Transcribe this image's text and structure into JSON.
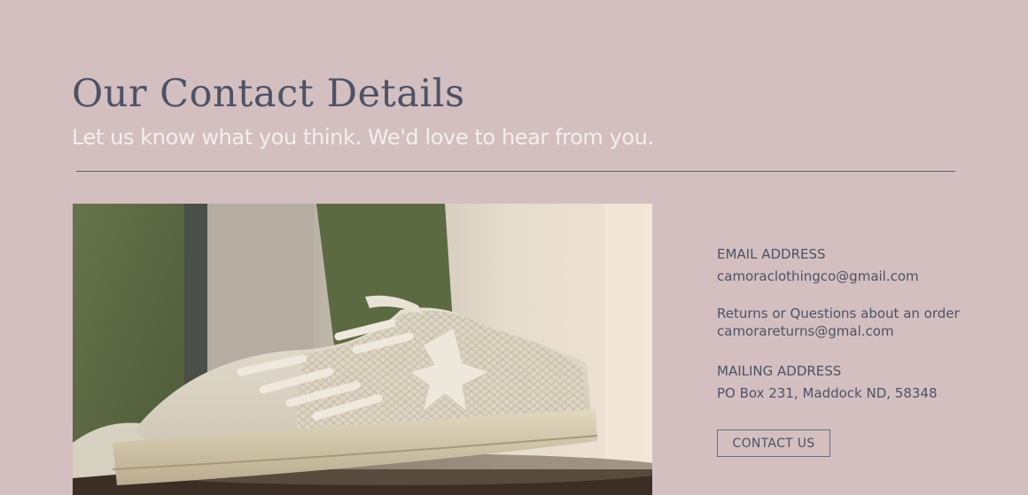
{
  "header": {
    "title": "Our Contact Details",
    "subtitle": "Let us know what you think. We'd love to hear from you."
  },
  "image": {
    "subject": "white star sneaker",
    "icon": "sneaker-photo"
  },
  "contact": {
    "email_label": "EMAIL ADDRESS",
    "email_value": "camoraclothingco@gmail.com",
    "returns_label": "Returns or Questions about an order",
    "returns_value": "camorareturns@gmal.com",
    "mailing_label": "MAILING ADDRESS",
    "mailing_value": "PO Box 231, Maddock ND, 58348"
  },
  "actions": {
    "contact_button": "CONTACT US"
  },
  "colors": {
    "background": "#d3bfc0",
    "heading": "#4e5265",
    "subheading": "#f4eeee",
    "divider": "#5b6072"
  }
}
